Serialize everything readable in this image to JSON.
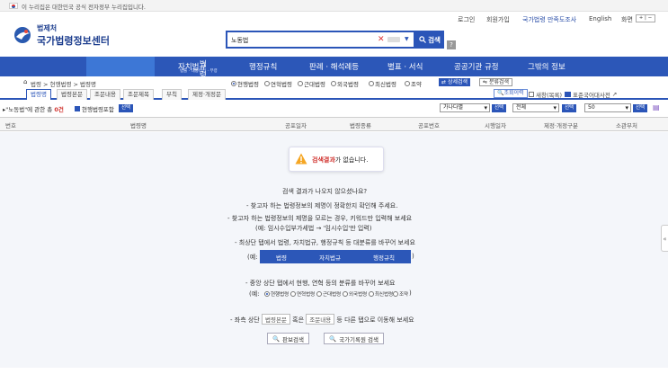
{
  "gov_banner": {
    "text": "이 누리집은 대한민국 공식 전자정부 누리집입니다."
  },
  "utility": {
    "login": "로그인",
    "signup": "회원가입",
    "satisfaction": "국가법령 만족도조사",
    "english": "English",
    "screen": "화면"
  },
  "logo": {
    "small": "법제처",
    "big": "국가법령정보센터"
  },
  "search": {
    "value": "노동법",
    "button": "검색",
    "help": "?"
  },
  "nav": {
    "active": {
      "label": "법령",
      "sub": "법률 · 대통령령 · 부령"
    },
    "items": [
      "자치법규",
      "행정규칙",
      "판례 · 해석례등",
      "별표 · 서식",
      "공공기관 규정",
      "그밖의 정보"
    ]
  },
  "breadcrumb": "법령 > 현행법령 > 법령명",
  "radios": [
    {
      "label": "현행법령",
      "on": true
    },
    {
      "label": "연혁법령",
      "on": false
    },
    {
      "label": "근대법령",
      "on": false
    },
    {
      "label": "외국법령",
      "on": false
    },
    {
      "label": "최신법령",
      "on": false
    },
    {
      "label": "조약",
      "on": false
    }
  ],
  "detail_search": "상세검색",
  "category_search": "분류검색",
  "tabs": [
    "법령명",
    "법령본문",
    "조문내용",
    "조문제목",
    "부칙",
    "제정·개정문"
  ],
  "zoom": "조회이력",
  "new_window": "새창(목록)",
  "std_dict": "표준국어대사전",
  "result": {
    "prefix": "\"노동법\"에 관한",
    "count_label": "총",
    "count": "0건",
    "only_label": "현행법령포함",
    "select_btn": "선택"
  },
  "selects": {
    "order": "가나다별",
    "scope": "전체",
    "per_page": "50",
    "btn": "선택"
  },
  "columns": [
    "번호",
    "법령명",
    "공포일자",
    "법령종류",
    "공포번호",
    "시행일자",
    "제정·개정구분",
    "소관부처"
  ],
  "empty": {
    "box_red": "검색결과",
    "box_rest": "가 없습니다.",
    "q": "검색 결과가 나오지 않으셨나요?",
    "tip1": "- 찾고자 하는 법령정보의 제명이 정확한지 확인해 주세요.",
    "tip2": "- 찾고자 하는 법령정보의 제명을 모르는 경우, 키워드만 입력해 보세요",
    "tip2_ex": "(예: 임시수입부가세법 → '임시수입'만 입력)",
    "tip3": "- 최상단 탭에서 법령, 자치법규, 행정규칙 등 대분류를 바꾸어 보세요",
    "ex_prefix": "(예:",
    "ex_suffix": ")",
    "demo_tabs": [
      "법령",
      "자치법규",
      "행정규칙"
    ],
    "tip4": "- 중앙 상단 탭에서 현행, 연혁 등의 분류를 바꾸어 보세요",
    "demo_radios": [
      "현행법령",
      "연혁법령",
      "근대법령",
      "외국법령",
      "최신법령",
      "조약"
    ],
    "tip5_a": "- 좌측 상단",
    "tip5_chip1": "법령본문",
    "tip5_b": "혹은",
    "tip5_chip2": "조문내용",
    "tip5_c": "등 다른 탭으로 이동해 보세요",
    "btn1": "판보검색",
    "btn2": "국가기록원 검색"
  },
  "colors": {
    "primary": "#2c57b8",
    "active_nav": "#3d77d6",
    "warning": "#f5a623",
    "error": "#d0312d"
  }
}
